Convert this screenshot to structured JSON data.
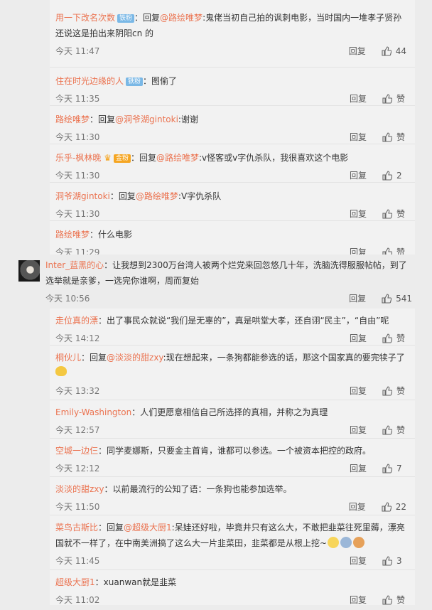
{
  "thread1": {
    "replies": [
      {
        "user": "用一下改名次数",
        "badge": "铁粉",
        "prefix": "：回复",
        "mention": "@路绘唯梦",
        "text": ":鬼佬当初自己拍的讽刺电影，当时国内一堆孝子贤孙还说这是拍出来阴阳cn 的",
        "time": "今天 11:47",
        "reply": "回复",
        "likes": "44"
      },
      {
        "user": "住在时光边缘的人",
        "badge": "铁粉",
        "prefix": "：",
        "mention": "",
        "text": "图偷了",
        "time": "今天 11:35",
        "reply": "回复",
        "likes": "赞"
      },
      {
        "user": "路绘唯梦",
        "badge": "",
        "prefix": "：回复",
        "mention": "@洞爷湖gintoki",
        "text": ":谢谢",
        "time": "今天 11:30",
        "reply": "回复",
        "likes": "赞"
      },
      {
        "user": "乐乎-枫林晚",
        "badge": "金粉",
        "prefix": "：回复",
        "mention": "@路绘唯梦",
        "text": ":v怪客或v字仇杀队，我很喜欢这个电影",
        "time": "今天 11:30",
        "reply": "回复",
        "likes": "2"
      },
      {
        "user": "洞爷湖gintoki",
        "badge": "",
        "prefix": "：回复",
        "mention": "@路绘唯梦",
        "text": ":V字仇杀队",
        "time": "今天 11:30",
        "reply": "回复",
        "likes": "赞"
      },
      {
        "user": "路绘唯梦",
        "badge": "",
        "prefix": "：",
        "mention": "",
        "text": "什么电影",
        "time": "今天 11:29",
        "reply": "回复",
        "likes": "赞"
      }
    ]
  },
  "main": {
    "user": "Inter_蓝黑的心",
    "text": "：让我想到2300万台湾人被两个烂党来回忽悠几十年，洗脑洗得服服帖帖，到了选举就是亲爹，一选完你谁啊，周而复始",
    "time": "今天 10:56",
    "reply": "回复",
    "likes": "541"
  },
  "thread2": {
    "replies": [
      {
        "user": "走位真的漂",
        "prefix": "：",
        "mention": "",
        "text": "出了事民众就说“我们是无辜的”，真是哄堂大孝，还自诩“民主”，“自由”呢",
        "time": "今天 14:12",
        "reply": "回复",
        "likes": "赞"
      },
      {
        "user": "桐伙儿",
        "prefix": "：回复",
        "mention": "@淡淡的甜zxy",
        "text": ":现在想起来，一条狗都能参选的话，那这个国家真的要完犊子了",
        "time": "今天 13:32",
        "reply": "回复",
        "likes": "赞"
      },
      {
        "user": "Emily-Washington",
        "prefix": "：",
        "mention": "",
        "text": "人们更愿意相信自己所选择的真相，并称之为真理",
        "time": "今天 12:57",
        "reply": "回复",
        "likes": "赞"
      },
      {
        "user": "空城一边仨",
        "prefix": "：",
        "mention": "",
        "text": "同学麦娜斯，只要金主首肯，谁都可以参选。一个被资本把控的政府。",
        "time": "今天 12:12",
        "reply": "回复",
        "likes": "7"
      },
      {
        "user": "淡淡的甜zxy",
        "prefix": "：",
        "mention": "",
        "text": "以前最流行的公知了语：一条狗也能参加选举。",
        "time": "今天 11:50",
        "reply": "回复",
        "likes": "22"
      },
      {
        "user": "菜鸟古斯比",
        "prefix": "：回复",
        "mention": "@超级大厨1",
        "text": ":呆娃还好啦，毕竟井只有这么大，不敢把韭菜往死里薅，漂亮国就不一样了，在中南美洲搞了这么大一片韭菜田，韭菜都是从根上挖~",
        "time": "今天 11:45",
        "reply": "回复",
        "likes": "3"
      },
      {
        "user": "超级大厨1",
        "prefix": "：",
        "mention": "",
        "text": "xuanwan就是韭菜",
        "time": "今天 11:02",
        "reply": "回复",
        "likes": "赞"
      }
    ]
  }
}
